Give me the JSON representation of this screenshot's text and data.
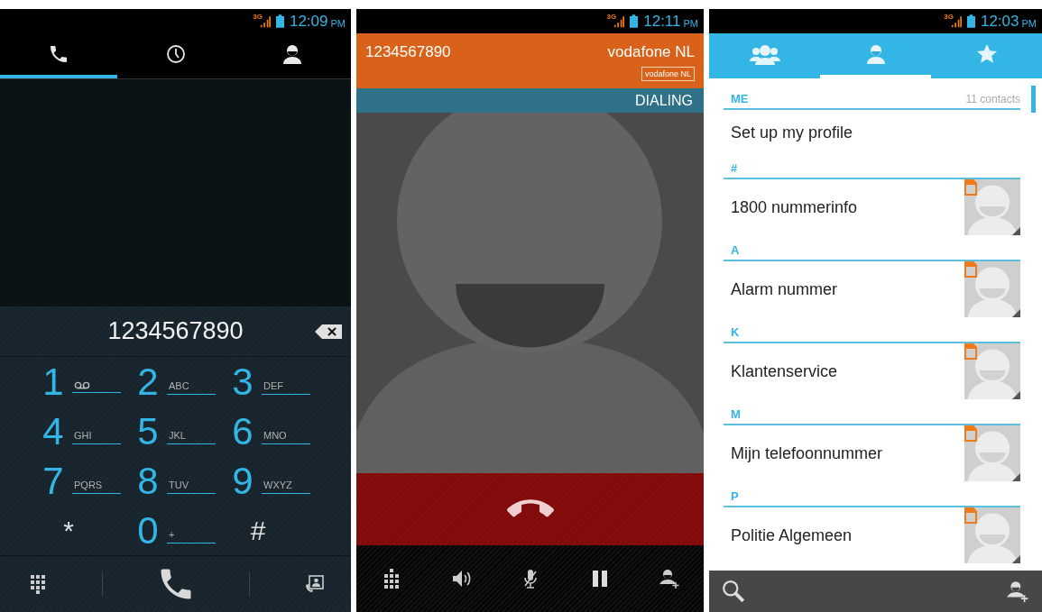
{
  "dialer": {
    "status_bar": {
      "network": "3G",
      "time": "12:09",
      "period": "PM"
    },
    "tabs": [
      {
        "selected": true
      },
      {
        "selected": false
      },
      {
        "selected": false
      }
    ],
    "number": "1234567890",
    "keys": [
      {
        "digit": "1",
        "kind": "voicemail"
      },
      {
        "digit": "2",
        "letters": "ABC",
        "kind": "letters"
      },
      {
        "digit": "3",
        "letters": "DEF",
        "kind": "letters"
      },
      {
        "digit": "4",
        "letters": "GHI",
        "kind": "letters"
      },
      {
        "digit": "5",
        "letters": "JKL",
        "kind": "letters"
      },
      {
        "digit": "6",
        "letters": "MNO",
        "kind": "letters"
      },
      {
        "digit": "7",
        "letters": "PQRS",
        "kind": "letters"
      },
      {
        "digit": "8",
        "letters": "TUV",
        "kind": "letters"
      },
      {
        "digit": "9",
        "letters": "WXYZ",
        "kind": "letters"
      },
      {
        "digit": "*",
        "kind": "symbol"
      },
      {
        "digit": "0",
        "letters": "+",
        "kind": "letters"
      },
      {
        "digit": "#",
        "kind": "symbol"
      }
    ]
  },
  "call": {
    "status_bar": {
      "network": "3G",
      "time": "12:11",
      "period": "PM"
    },
    "number": "1234567890",
    "carrier": "vodafone NL",
    "carrier_badge": "vodafone NL",
    "state": "DIALING"
  },
  "contacts": {
    "status_bar": {
      "network": "3G",
      "time": "12:03",
      "period": "PM"
    },
    "tabs": [
      {
        "selected": false
      },
      {
        "selected": true
      },
      {
        "selected": false
      }
    ],
    "sections": [
      {
        "header": "ME",
        "count": "11 contacts",
        "entries": [
          {
            "name": "Set up my profile",
            "kind": "profile"
          }
        ]
      },
      {
        "header": "#",
        "entries": [
          {
            "name": "1800 nummerinfo",
            "kind": "sim"
          }
        ]
      },
      {
        "header": "A",
        "entries": [
          {
            "name": "Alarm nummer",
            "kind": "sim"
          }
        ]
      },
      {
        "header": "K",
        "entries": [
          {
            "name": "Klantenservice",
            "kind": "sim"
          }
        ]
      },
      {
        "header": "M",
        "entries": [
          {
            "name": "Mijn telefoonnummer",
            "kind": "sim"
          }
        ]
      },
      {
        "header": "P",
        "entries": [
          {
            "name": "Politie Algemeen",
            "kind": "sim"
          }
        ]
      }
    ]
  }
}
